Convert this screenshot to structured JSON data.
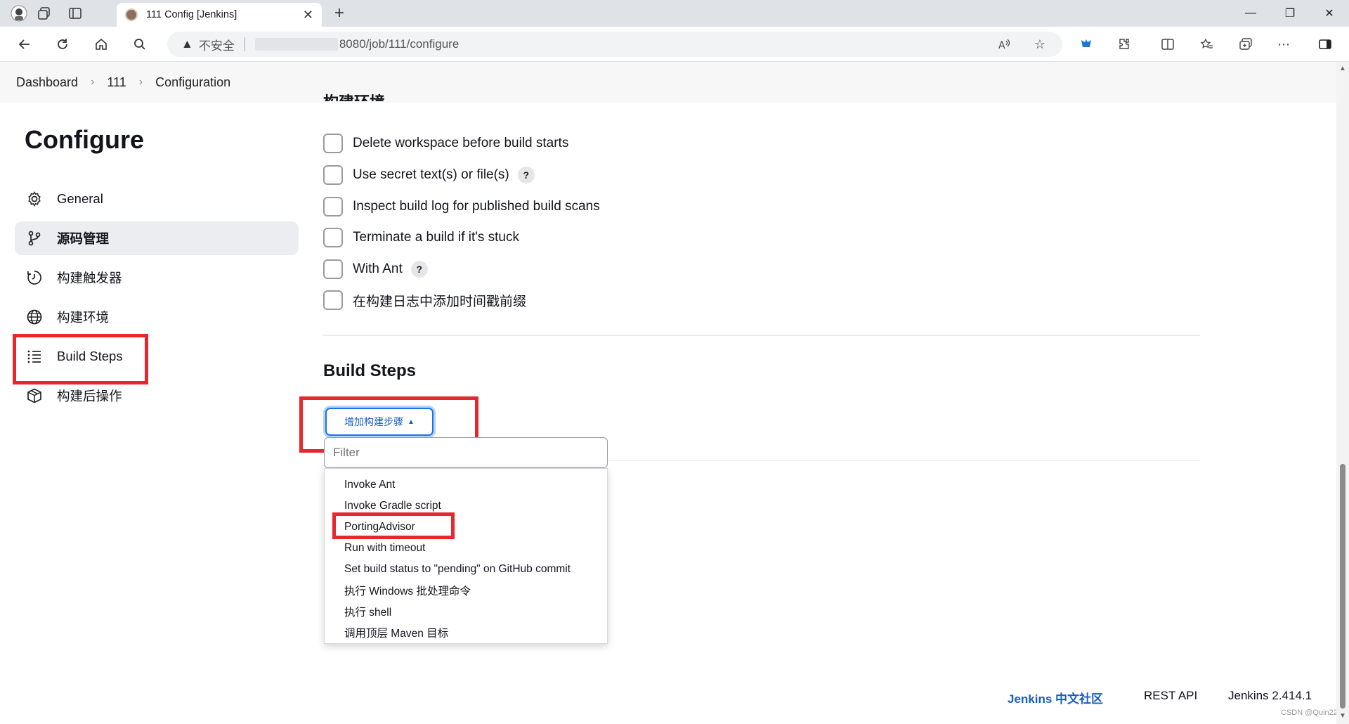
{
  "browser": {
    "tab_title": "111 Config [Jenkins]",
    "security_label": "不安全",
    "url_path": "8080/job/111/configure"
  },
  "breadcrumb": {
    "items": [
      "Dashboard",
      "111",
      "Configuration"
    ]
  },
  "sidebar": {
    "title": "Configure",
    "items": [
      {
        "label": "General",
        "icon": "gear-icon"
      },
      {
        "label": "源码管理",
        "icon": "branch-icon"
      },
      {
        "label": "构建触发器",
        "icon": "clock-icon"
      },
      {
        "label": "构建环境",
        "icon": "globe-icon"
      },
      {
        "label": "Build Steps",
        "icon": "list-icon"
      },
      {
        "label": "构建后操作",
        "icon": "package-icon"
      }
    ]
  },
  "main": {
    "partial_section_title": "构建环境",
    "options": [
      {
        "label": "Delete workspace before build starts",
        "help": false
      },
      {
        "label": "Use secret text(s) or file(s)",
        "help": true
      },
      {
        "label": "Inspect build log for published build scans",
        "help": false
      },
      {
        "label": "Terminate a build if it's stuck",
        "help": false
      },
      {
        "label": "With Ant",
        "help": true
      },
      {
        "label": "在构建日志中添加时间戳前缀",
        "help": false
      }
    ],
    "help_glyph": "?",
    "build_steps_heading": "Build Steps",
    "add_step_button": "增加构建步骤",
    "filter_placeholder": "Filter",
    "menu_items": [
      "Invoke Ant",
      "Invoke Gradle script",
      "PortingAdvisor",
      "Run with timeout",
      "Set build status to \"pending\" on GitHub commit",
      "执行 Windows 批处理命令",
      "执行 shell",
      "调用顶层 Maven 目标"
    ]
  },
  "footer": {
    "community_link": "Jenkins 中文社区",
    "rest_api": "REST API",
    "version": "Jenkins 2.414.1"
  },
  "watermark": "CSDN @Quin22",
  "colors": {
    "highlight": "#e8262e",
    "link_blue": "#1a5ec2",
    "active_bg": "#ebedf0"
  }
}
